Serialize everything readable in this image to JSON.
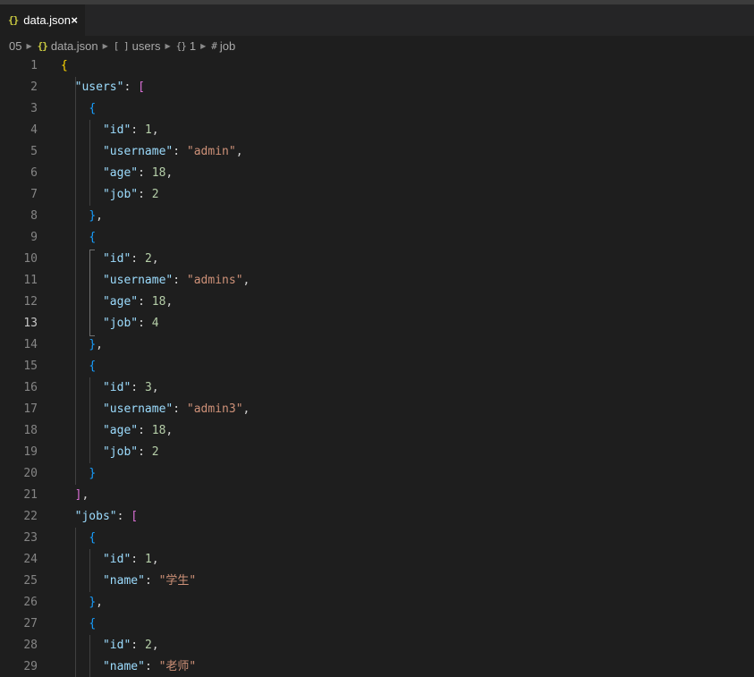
{
  "tab": {
    "icon": "{}",
    "label": "data.json",
    "close": "×"
  },
  "breadcrumb": {
    "items": [
      {
        "icon": "",
        "label": "05"
      },
      {
        "icon": "{}",
        "label": "data.json"
      },
      {
        "icon": "[ ]",
        "label": "users"
      },
      {
        "icon": "{}",
        "label": "1"
      },
      {
        "icon": "#",
        "label": "job"
      }
    ],
    "separator": "▶"
  },
  "editor": {
    "active_line": 13,
    "lines": [
      {
        "n": "1",
        "tokens": [
          [
            "b1",
            "{"
          ]
        ]
      },
      {
        "n": "2",
        "tokens": [
          [
            "sp",
            "  "
          ],
          [
            "key",
            "\"users\""
          ],
          [
            "punc",
            ": "
          ],
          [
            "b2",
            "["
          ]
        ]
      },
      {
        "n": "3",
        "tokens": [
          [
            "sp",
            "    "
          ],
          [
            "b3",
            "{"
          ]
        ]
      },
      {
        "n": "4",
        "tokens": [
          [
            "sp",
            "      "
          ],
          [
            "key",
            "\"id\""
          ],
          [
            "punc",
            ": "
          ],
          [
            "num",
            "1"
          ],
          [
            "punc",
            ","
          ]
        ]
      },
      {
        "n": "5",
        "tokens": [
          [
            "sp",
            "      "
          ],
          [
            "key",
            "\"username\""
          ],
          [
            "punc",
            ": "
          ],
          [
            "str",
            "\"admin\""
          ],
          [
            "punc",
            ","
          ]
        ]
      },
      {
        "n": "6",
        "tokens": [
          [
            "sp",
            "      "
          ],
          [
            "key",
            "\"age\""
          ],
          [
            "punc",
            ": "
          ],
          [
            "num",
            "18"
          ],
          [
            "punc",
            ","
          ]
        ]
      },
      {
        "n": "7",
        "tokens": [
          [
            "sp",
            "      "
          ],
          [
            "key",
            "\"job\""
          ],
          [
            "punc",
            ": "
          ],
          [
            "num",
            "2"
          ]
        ]
      },
      {
        "n": "8",
        "tokens": [
          [
            "sp",
            "    "
          ],
          [
            "b3",
            "}"
          ],
          [
            "punc",
            ","
          ]
        ]
      },
      {
        "n": "9",
        "tokens": [
          [
            "sp",
            "    "
          ],
          [
            "b3",
            "{"
          ]
        ]
      },
      {
        "n": "10",
        "tokens": [
          [
            "sp",
            "      "
          ],
          [
            "key",
            "\"id\""
          ],
          [
            "punc",
            ": "
          ],
          [
            "num",
            "2"
          ],
          [
            "punc",
            ","
          ]
        ]
      },
      {
        "n": "11",
        "tokens": [
          [
            "sp",
            "      "
          ],
          [
            "key",
            "\"username\""
          ],
          [
            "punc",
            ": "
          ],
          [
            "str",
            "\"admins\""
          ],
          [
            "punc",
            ","
          ]
        ]
      },
      {
        "n": "12",
        "tokens": [
          [
            "sp",
            "      "
          ],
          [
            "key",
            "\"age\""
          ],
          [
            "punc",
            ": "
          ],
          [
            "num",
            "18"
          ],
          [
            "punc",
            ","
          ]
        ]
      },
      {
        "n": "13",
        "tokens": [
          [
            "sp",
            "      "
          ],
          [
            "key",
            "\"job\""
          ],
          [
            "punc",
            ": "
          ],
          [
            "num",
            "4"
          ]
        ]
      },
      {
        "n": "14",
        "tokens": [
          [
            "sp",
            "    "
          ],
          [
            "b3",
            "}"
          ],
          [
            "punc",
            ","
          ]
        ]
      },
      {
        "n": "15",
        "tokens": [
          [
            "sp",
            "    "
          ],
          [
            "b3",
            "{"
          ]
        ]
      },
      {
        "n": "16",
        "tokens": [
          [
            "sp",
            "      "
          ],
          [
            "key",
            "\"id\""
          ],
          [
            "punc",
            ": "
          ],
          [
            "num",
            "3"
          ],
          [
            "punc",
            ","
          ]
        ]
      },
      {
        "n": "17",
        "tokens": [
          [
            "sp",
            "      "
          ],
          [
            "key",
            "\"username\""
          ],
          [
            "punc",
            ": "
          ],
          [
            "str",
            "\"admin3\""
          ],
          [
            "punc",
            ","
          ]
        ]
      },
      {
        "n": "18",
        "tokens": [
          [
            "sp",
            "      "
          ],
          [
            "key",
            "\"age\""
          ],
          [
            "punc",
            ": "
          ],
          [
            "num",
            "18"
          ],
          [
            "punc",
            ","
          ]
        ]
      },
      {
        "n": "19",
        "tokens": [
          [
            "sp",
            "      "
          ],
          [
            "key",
            "\"job\""
          ],
          [
            "punc",
            ": "
          ],
          [
            "num",
            "2"
          ]
        ]
      },
      {
        "n": "20",
        "tokens": [
          [
            "sp",
            "    "
          ],
          [
            "b3",
            "}"
          ]
        ]
      },
      {
        "n": "21",
        "tokens": [
          [
            "sp",
            "  "
          ],
          [
            "b2",
            "]"
          ],
          [
            "punc",
            ","
          ]
        ]
      },
      {
        "n": "22",
        "tokens": [
          [
            "sp",
            "  "
          ],
          [
            "key",
            "\"jobs\""
          ],
          [
            "punc",
            ": "
          ],
          [
            "b2",
            "["
          ]
        ]
      },
      {
        "n": "23",
        "tokens": [
          [
            "sp",
            "    "
          ],
          [
            "b3",
            "{"
          ]
        ]
      },
      {
        "n": "24",
        "tokens": [
          [
            "sp",
            "      "
          ],
          [
            "key",
            "\"id\""
          ],
          [
            "punc",
            ": "
          ],
          [
            "num",
            "1"
          ],
          [
            "punc",
            ","
          ]
        ]
      },
      {
        "n": "25",
        "tokens": [
          [
            "sp",
            "      "
          ],
          [
            "key",
            "\"name\""
          ],
          [
            "punc",
            ": "
          ],
          [
            "str",
            "\"学生\""
          ]
        ]
      },
      {
        "n": "26",
        "tokens": [
          [
            "sp",
            "    "
          ],
          [
            "b3",
            "}"
          ],
          [
            "punc",
            ","
          ]
        ]
      },
      {
        "n": "27",
        "tokens": [
          [
            "sp",
            "    "
          ],
          [
            "b3",
            "{"
          ]
        ]
      },
      {
        "n": "28",
        "tokens": [
          [
            "sp",
            "      "
          ],
          [
            "key",
            "\"id\""
          ],
          [
            "punc",
            ": "
          ],
          [
            "num",
            "2"
          ],
          [
            "punc",
            ","
          ]
        ]
      },
      {
        "n": "29",
        "tokens": [
          [
            "sp",
            "      "
          ],
          [
            "key",
            "\"name\""
          ],
          [
            "punc",
            ": "
          ],
          [
            "str",
            "\"老师\""
          ]
        ]
      }
    ]
  },
  "colors": {
    "background": "#1e1e1e",
    "tabbar": "#252526",
    "key": "#9cdcfe",
    "string": "#ce9178",
    "number": "#b5cea8",
    "bracket_level1": "#ffd700",
    "bracket_level2": "#da70d6",
    "bracket_level3": "#179fff"
  }
}
